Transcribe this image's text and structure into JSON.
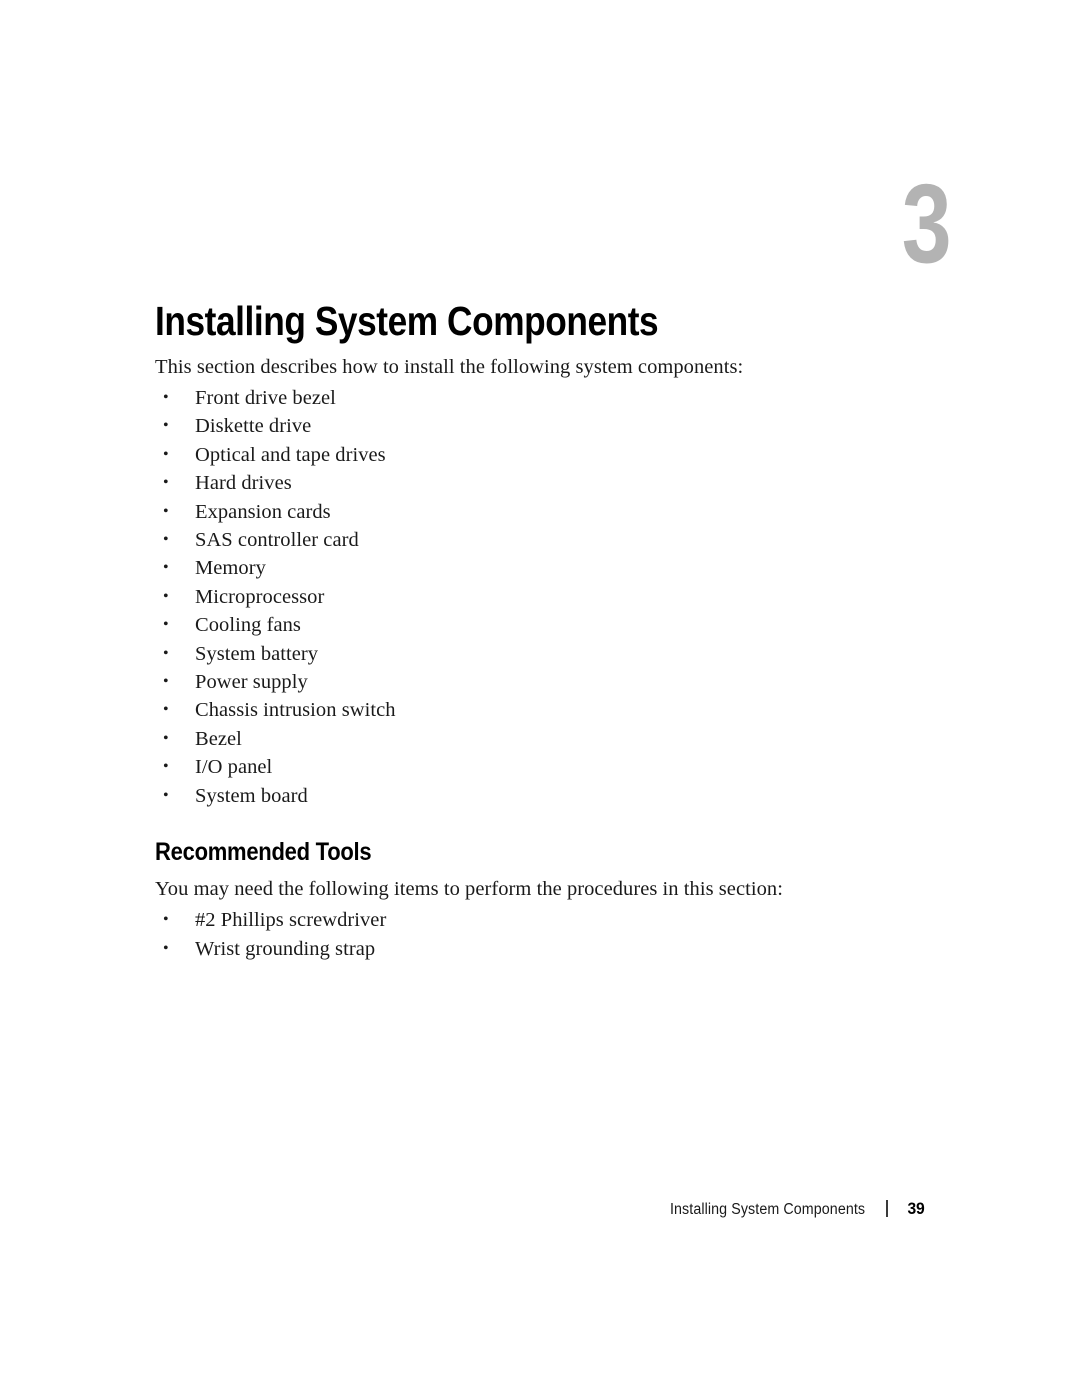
{
  "chapter": {
    "number": "3",
    "title": "Installing System Components"
  },
  "intro": {
    "paragraph": "This section describes how to install the following system components:",
    "bullet_symbol": "•",
    "items": [
      "Front drive bezel",
      "Diskette drive",
      "Optical and tape drives",
      "Hard drives",
      "Expansion cards",
      "SAS controller card",
      "Memory",
      "Microprocessor",
      "Cooling fans",
      "System battery",
      "Power supply",
      "Chassis intrusion switch",
      "Bezel",
      "I/O panel",
      "System board"
    ]
  },
  "recommended_tools": {
    "heading": "Recommended Tools",
    "paragraph": "You may need the following items to perform the procedures in this section:",
    "bullet_symbol": "•",
    "items": [
      "#2 Phillips screwdriver",
      "Wrist grounding strap"
    ]
  },
  "footer": {
    "title": "Installing System Components",
    "page_number": "39"
  },
  "colors": {
    "chapter_number": "#b3b3b3",
    "text": "#1a1a1a",
    "heading": "#000000",
    "background": "#ffffff"
  }
}
